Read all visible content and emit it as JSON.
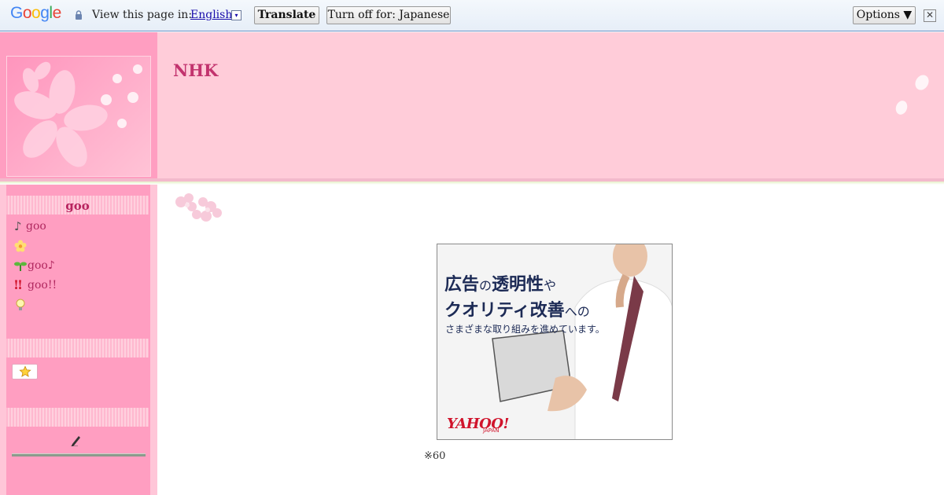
{
  "translate_bar": {
    "logo_text": "Google",
    "view_text": "View this page in:",
    "language": "English",
    "dropdown_glyph": "▾",
    "translate_label": "Translate",
    "turn_off_label": "Turn off for: Japanese",
    "options_label": "Options ▼",
    "close_glyph": "✕"
  },
  "header": {
    "site_title": "NHK"
  },
  "sidebar": {
    "title": "goo",
    "items": [
      {
        "icon": "music-note-icon",
        "glyph": "♪",
        "label": "goo"
      },
      {
        "icon": "flower-icon",
        "glyph": "",
        "label": ""
      },
      {
        "icon": "sprout-icon",
        "glyph": "",
        "label": "goo♪"
      },
      {
        "icon": "double-exclamation-icon",
        "glyph": "‼",
        "label": "goo!!"
      },
      {
        "icon": "lightbulb-icon",
        "glyph": "",
        "label": ""
      }
    ],
    "star_icon": "star-icon",
    "pen_icon": "pen-icon"
  },
  "ad": {
    "line1_a": "広告",
    "line1_b": "の",
    "line1_c": "透明性",
    "line1_d": "や",
    "line2_a": "クオリティ改善",
    "line2_b": "への",
    "line3": "さまざまな取り組みを進めています。",
    "logo": "YAHOO!",
    "logo_sub": "JAPAN"
  },
  "main": {
    "note": "※60"
  },
  "colors": {
    "header_bg": "#ffccd9",
    "sidebar_pink": "#ff9ec1",
    "title_color": "#c2336e",
    "ad_text": "#1c2a55",
    "yahoo_red": "#d0142c"
  }
}
